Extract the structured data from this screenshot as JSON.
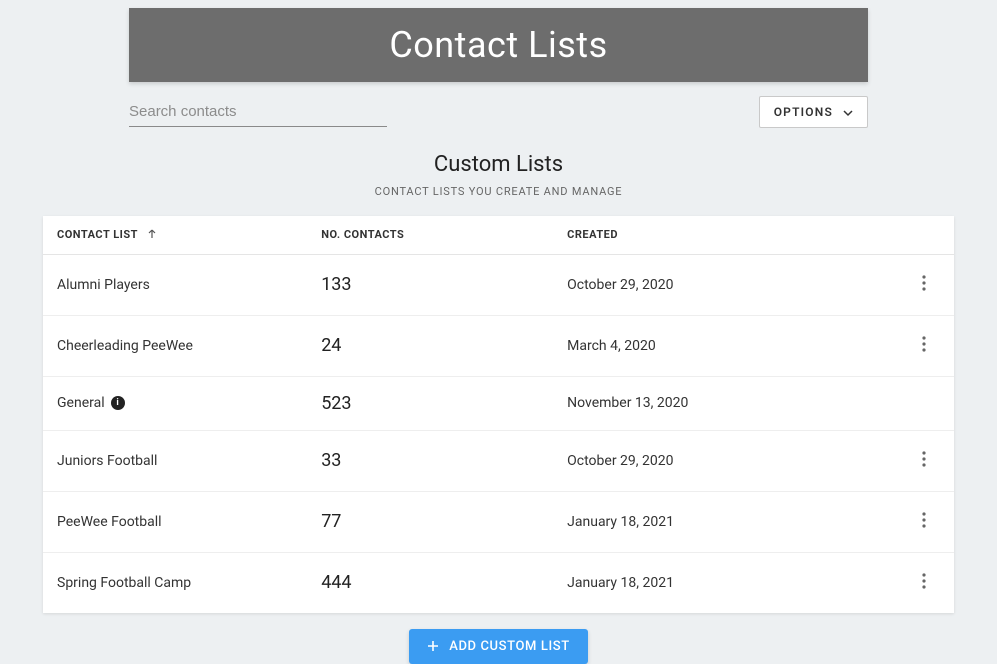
{
  "header": {
    "title": "Contact Lists"
  },
  "toolbar": {
    "search_placeholder": "Search contacts",
    "options_label": "OPTIONS"
  },
  "section": {
    "title": "Custom Lists",
    "subtitle": "CONTACT LISTS YOU CREATE AND MANAGE"
  },
  "columns": {
    "name": "CONTACT LIST",
    "count": "NO. CONTACTS",
    "created": "CREATED"
  },
  "rows": [
    {
      "name": "Alumni Players",
      "count": "133",
      "created": "October 29, 2020",
      "info": false,
      "menu": true
    },
    {
      "name": "Cheerleading PeeWee",
      "count": "24",
      "created": "March 4, 2020",
      "info": false,
      "menu": true
    },
    {
      "name": "General",
      "count": "523",
      "created": "November 13, 2020",
      "info": true,
      "menu": false
    },
    {
      "name": "Juniors Football",
      "count": "33",
      "created": "October 29, 2020",
      "info": false,
      "menu": true
    },
    {
      "name": "PeeWee Football",
      "count": "77",
      "created": "January 18, 2021",
      "info": false,
      "menu": true
    },
    {
      "name": "Spring Football Camp",
      "count": "444",
      "created": "January 18, 2021",
      "info": false,
      "menu": true
    }
  ],
  "add_button": {
    "label": "ADD CUSTOM LIST"
  }
}
